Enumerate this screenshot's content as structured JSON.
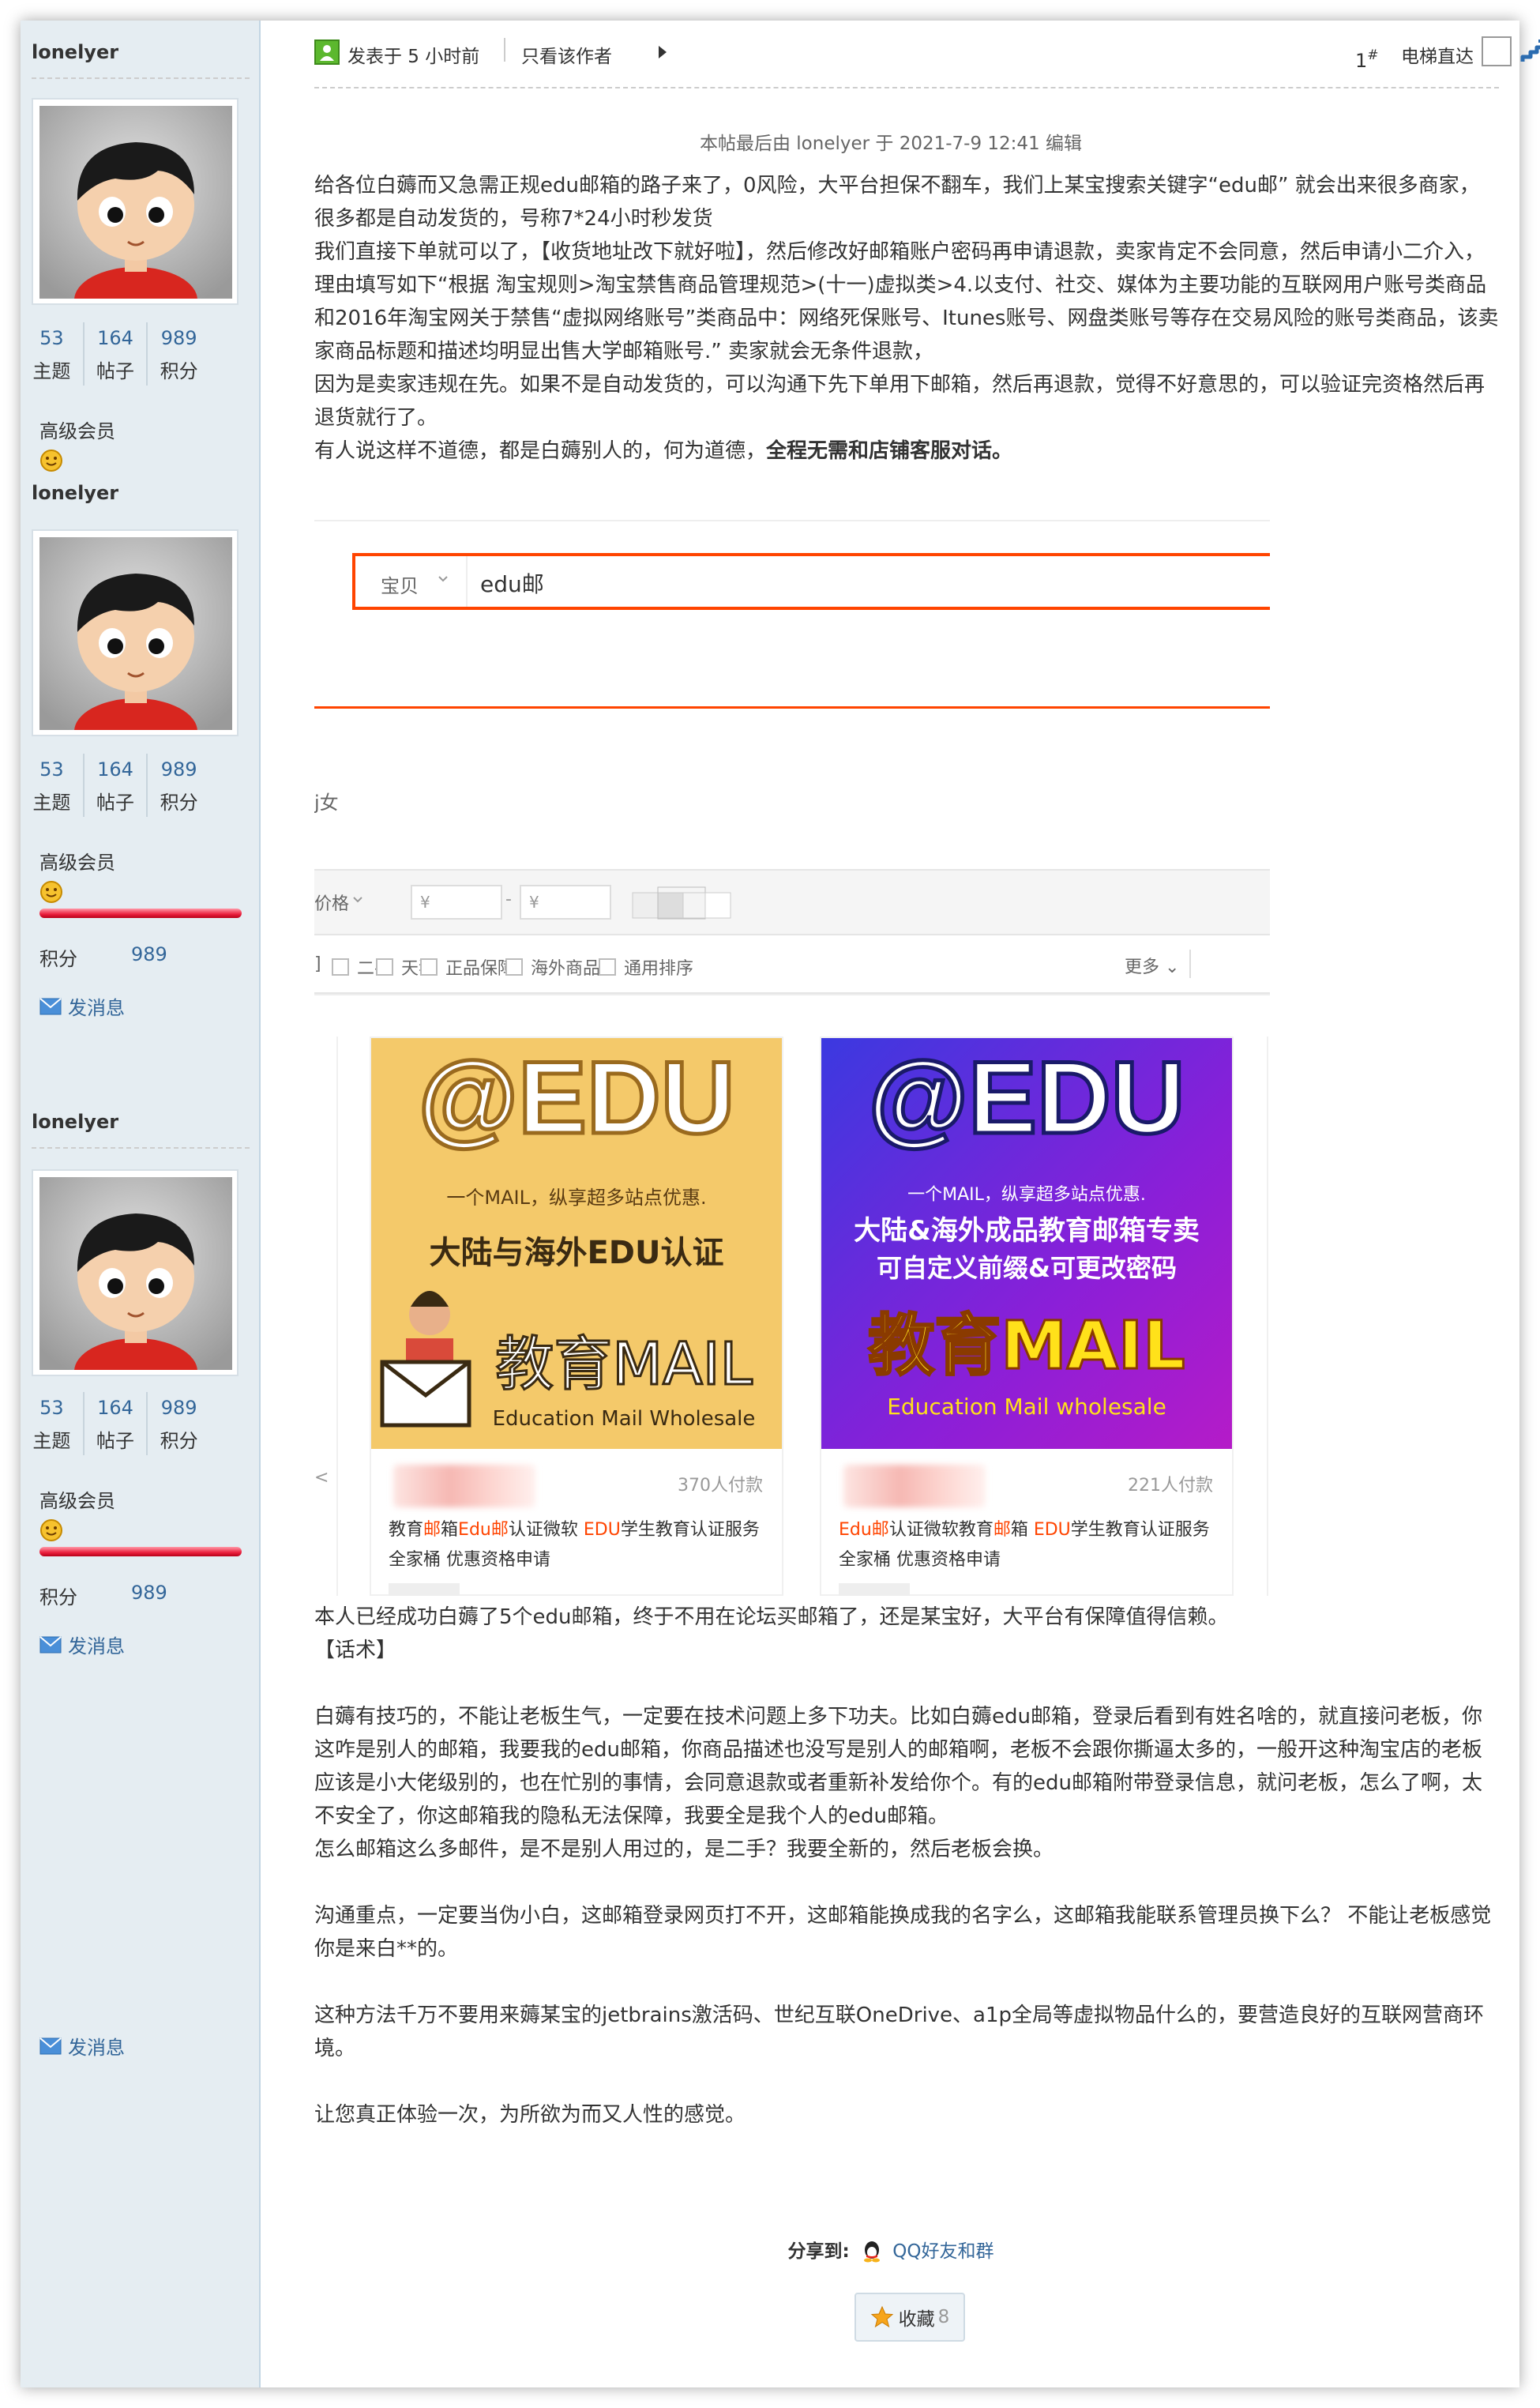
{
  "profiles": [
    {
      "username": "lonelyer",
      "stats": [
        {
          "value": "53",
          "label": "主题"
        },
        {
          "value": "164",
          "label": "帖子"
        },
        {
          "value": "989",
          "label": "积分"
        }
      ],
      "rank": "高级会员"
    },
    {
      "username": "lonelyer",
      "stats": [
        {
          "value": "53",
          "label": "主题"
        },
        {
          "value": "164",
          "label": "帖子"
        },
        {
          "value": "989",
          "label": "积分"
        }
      ],
      "rank": "高级会员",
      "points_label": "积分",
      "points_value": "989",
      "message": "发消息"
    },
    {
      "username": "lonelyer",
      "stats": [
        {
          "value": "53",
          "label": "主题"
        },
        {
          "value": "164",
          "label": "帖子"
        },
        {
          "value": "989",
          "label": "积分"
        }
      ],
      "rank": "高级会员",
      "points_label": "积分",
      "points_value": "989",
      "message": "发消息"
    }
  ],
  "sidebar_bottom_message": "发消息",
  "header": {
    "posted": "发表于 5 小时前",
    "only_author": "只看该作者",
    "floor": "1",
    "floor_suffix": "#",
    "jump_label": "电梯直达"
  },
  "edited_note": "本帖最后由 lonelyer 于 2021-7-9 12:41 编辑",
  "post_intro": [
    "给各位白薅而又急需正规edu邮箱的路子来了，0风险，大平台担保不翻车，我们上某宝搜索关键字“edu邮” 就会出来很多商家，很多都是自动发货的，号称7*24小时秒发货",
    "我们直接下单就可以了，【收货地址改下就好啦】，然后修改好邮箱账户密码再申请退款，卖家肯定不会同意，然后申请小二介入，",
    "理由填写如下“根据 淘宝规则>淘宝禁售商品管理规范>(十一)虚拟类>4.以支付、社交、媒体为主要功能的互联网用户账号类商品和2016年淘宝网关于禁售“虚拟网络账号”类商品中：网络死保账号、Itunes账号、网盘类账号等存在交易风险的账号类商品，该卖家商品标题和描述均明显出售大学邮箱账号.”  卖家就会无条件退款，",
    "因为是卖家违规在先。如果不是自动发货的，可以沟通下先下单用下邮箱，然后再退款，觉得不好意思的，可以验证完资格然后再退货就行了。"
  ],
  "post_intro_last_plain": "有人说这样不道德，都是白薅别人的，何为道德，",
  "post_intro_last_bold": "全程无需和店铺客服对话。",
  "screenshot": {
    "search_type": "宝贝",
    "search_query": "edu邮",
    "fragment_1": "j女",
    "price_label": "价格",
    "price_from": "¥",
    "price_dash": "-",
    "price_to": "¥",
    "options": [
      "二手",
      "天猫",
      "正品保障",
      "海外商品",
      "通用排序"
    ],
    "more": "更多",
    "frag_bracket": "]",
    "cards": [
      {
        "big": "@EDU",
        "line1": "一个MAIL，纵享超多站点优惠.",
        "line2": "大陆与海外EDU认证",
        "brand": "教育MAIL",
        "sub": "Education Mail Wholesale",
        "buyers": "370人付款",
        "title_parts": [
          "教育",
          "邮",
          "箱",
          "Edu邮",
          "认证微软 ",
          "EDU",
          "学生教育认证服务全家桶 优惠资格申请"
        ]
      },
      {
        "big": "@EDU",
        "line1": "一个MAIL，纵享超多站点优惠.",
        "line2": "大陆&海外成品教育邮箱专卖",
        "line3": "可自定义前缀&可更改密码",
        "brand": "教育MAIL",
        "sub": "Education Mail wholesale",
        "buyers": "221人付款",
        "title_parts": [
          "Edu邮",
          "认证微软教育",
          "邮",
          "箱 ",
          "EDU",
          "学生教育认证服务全家桶 优惠资格申请"
        ]
      }
    ]
  },
  "post_body": [
    "本人已经成功白薅了5个edu邮箱，终于不用在论坛买邮箱了，还是某宝好，大平台有保障值得信赖。",
    "【话术】",
    "",
    "白薅有技巧的，不能让老板生气，一定要在技术问题上多下功夫。比如白薅edu邮箱，登录后看到有姓名啥的，就直接问老板，你这咋是别人的邮箱，我要我的edu邮箱，你商品描述也没写是别人的邮箱啊，老板不会跟你撕逼太多的，一般开这种淘宝店的老板应该是小大佬级别的，也在忙别的事情，会同意退款或者重新补发给你个。有的edu邮箱附带登录信息，就问老板，怎么了啊，太不安全了，你这邮箱我的隐私无法保障，我要全是我个人的edu邮箱。",
    "怎么邮箱这么多邮件，是不是别人用过的，是二手？我要全新的，然后老板会换。",
    "",
    "沟通重点，一定要当伪小白，这邮箱登录网页打不开，这邮箱能换成我的名字么，这邮箱我能联系管理员换下么？  不能让老板感觉你是来白**的。",
    "",
    "这种方法千万不要用来薅某宝的jetbrains激活码、世纪互联OneDrive、a1p全局等虚拟物品什么的，要营造良好的互联网营商环境。",
    "",
    "让您真正体验一次，为所欲为而又人性的感觉。"
  ],
  "share": {
    "label": "分享到:",
    "target": "QQ好友和群"
  },
  "favorite": {
    "label": "收藏",
    "count": "8"
  },
  "colors": {
    "sidebar_bg": "#e5edf2",
    "link": "#336699",
    "taobao_orange": "#ff4400"
  }
}
